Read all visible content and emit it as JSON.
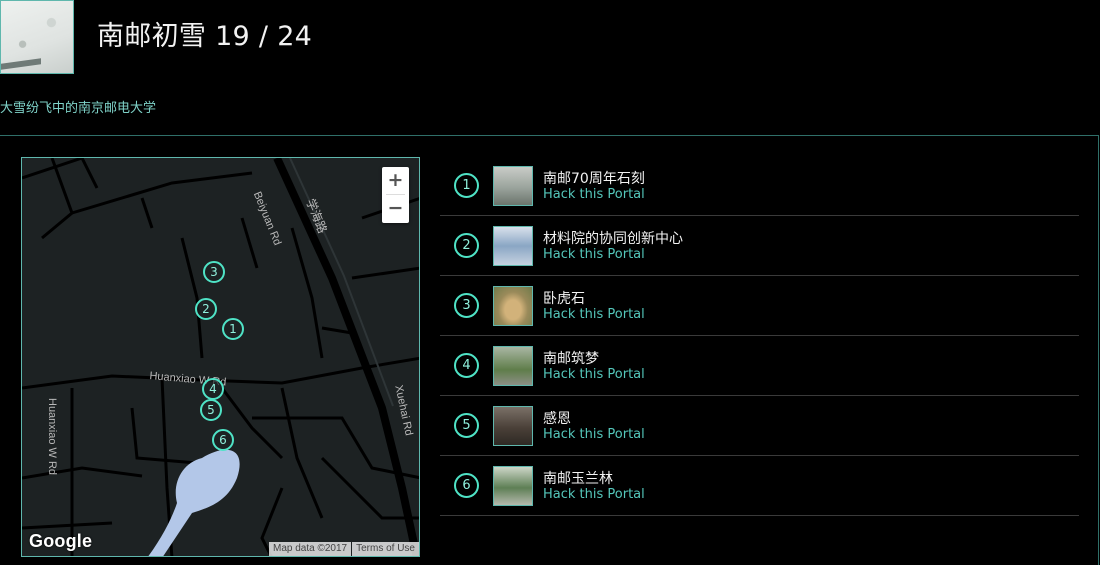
{
  "header": {
    "title": "南邮初雪 19 / 24",
    "subtitle": "大雪纷飞中的南京邮电大学"
  },
  "map": {
    "zoom_in": "+",
    "zoom_out": "−",
    "google_label": "Google",
    "attribution": "Map data ©2017",
    "terms": "Terms of Use",
    "road_labels": {
      "beiyuan": "Beiyuan Rd",
      "xuehai_cn": "学海路",
      "huanxiao": "Huanxiao W Rd",
      "huanxiao_vertical": "Huanxiao W Rd",
      "xuehai": "Xuehai Rd"
    },
    "markers": [
      "3",
      "2",
      "1",
      "4",
      "5",
      "6"
    ]
  },
  "portals": [
    {
      "num": "1",
      "name": "南邮70周年石刻",
      "action": "Hack this Portal",
      "thumb_color": "#9aa39c"
    },
    {
      "num": "2",
      "name": "材料院的协同创新中心",
      "action": "Hack this Portal",
      "thumb_color": "#8aa6c4"
    },
    {
      "num": "3",
      "name": "卧虎石",
      "action": "Hack this Portal",
      "thumb_color": "#9a8a5a"
    },
    {
      "num": "4",
      "name": "南邮筑梦",
      "action": "Hack this Portal",
      "thumb_color": "#5f7d4a"
    },
    {
      "num": "5",
      "name": "感恩",
      "action": "Hack this Portal",
      "thumb_color": "#4a4038"
    },
    {
      "num": "6",
      "name": "南邮玉兰林",
      "action": "Hack this Portal",
      "thumb_color": "#5e7f55"
    }
  ],
  "colors": {
    "accent": "#4fe3c6",
    "link": "#55c7bb",
    "subtitle": "#7fd3c9"
  }
}
